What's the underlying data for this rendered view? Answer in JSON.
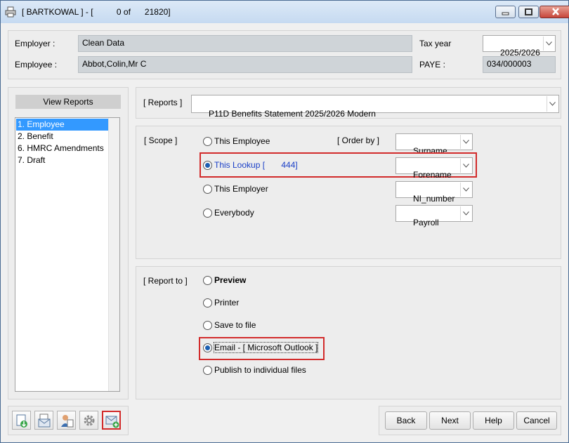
{
  "window": {
    "title": "[ BARTKOWAL ] - [          0 of      21820]"
  },
  "header": {
    "employer_label": "Employer :",
    "employer_value": "Clean Data",
    "employee_label": "Employee :",
    "employee_value": "Abbot,Colin,Mr C",
    "tax_year_label": "Tax year",
    "tax_year_value": "2025/2026",
    "paye_label": "PAYE :",
    "paye_value": "034/000003"
  },
  "sidebar": {
    "title": "View Reports",
    "items": [
      {
        "label": "1. Employee",
        "selected": true
      },
      {
        "label": "2. Benefit",
        "selected": false
      },
      {
        "label": "6. HMRC Amendments",
        "selected": false
      },
      {
        "label": "7. Draft",
        "selected": false
      }
    ]
  },
  "reports": {
    "label": "[ Reports ]",
    "selected": "P11D Benefits Statement 2025/2026 Modern"
  },
  "scope": {
    "label": "[ Scope ]",
    "order_by_label": "[ Order by ]",
    "options": [
      {
        "label": "This Employee",
        "checked": false,
        "order": "Surname"
      },
      {
        "label": "This Lookup [       444]",
        "checked": true,
        "order": "Forename"
      },
      {
        "label": "This Employer",
        "checked": false,
        "order": "NI_number"
      },
      {
        "label": "Everybody",
        "checked": false,
        "order": "Payroll"
      }
    ]
  },
  "report_to": {
    "label": "[ Report to ]",
    "options": [
      {
        "label": "Preview",
        "checked": false,
        "bold": true
      },
      {
        "label": "Printer",
        "checked": false,
        "bold": false
      },
      {
        "label": "Save to file",
        "checked": false,
        "bold": false
      },
      {
        "label": "Email - [ Microsoft Outlook ]",
        "checked": true,
        "bold": false
      },
      {
        "label": "Publish to individual files",
        "checked": false,
        "bold": false
      }
    ]
  },
  "buttons": {
    "back": "Back",
    "next": "Next",
    "help": "Help",
    "cancel": "Cancel"
  },
  "toolbar_icons": [
    "export-icon",
    "email-icon",
    "users-icon",
    "gear-icon",
    "email-add-icon"
  ],
  "colors": {
    "highlight_border": "#d22b2b",
    "selection": "#3399ff",
    "link_text": "#1a3fc7"
  }
}
